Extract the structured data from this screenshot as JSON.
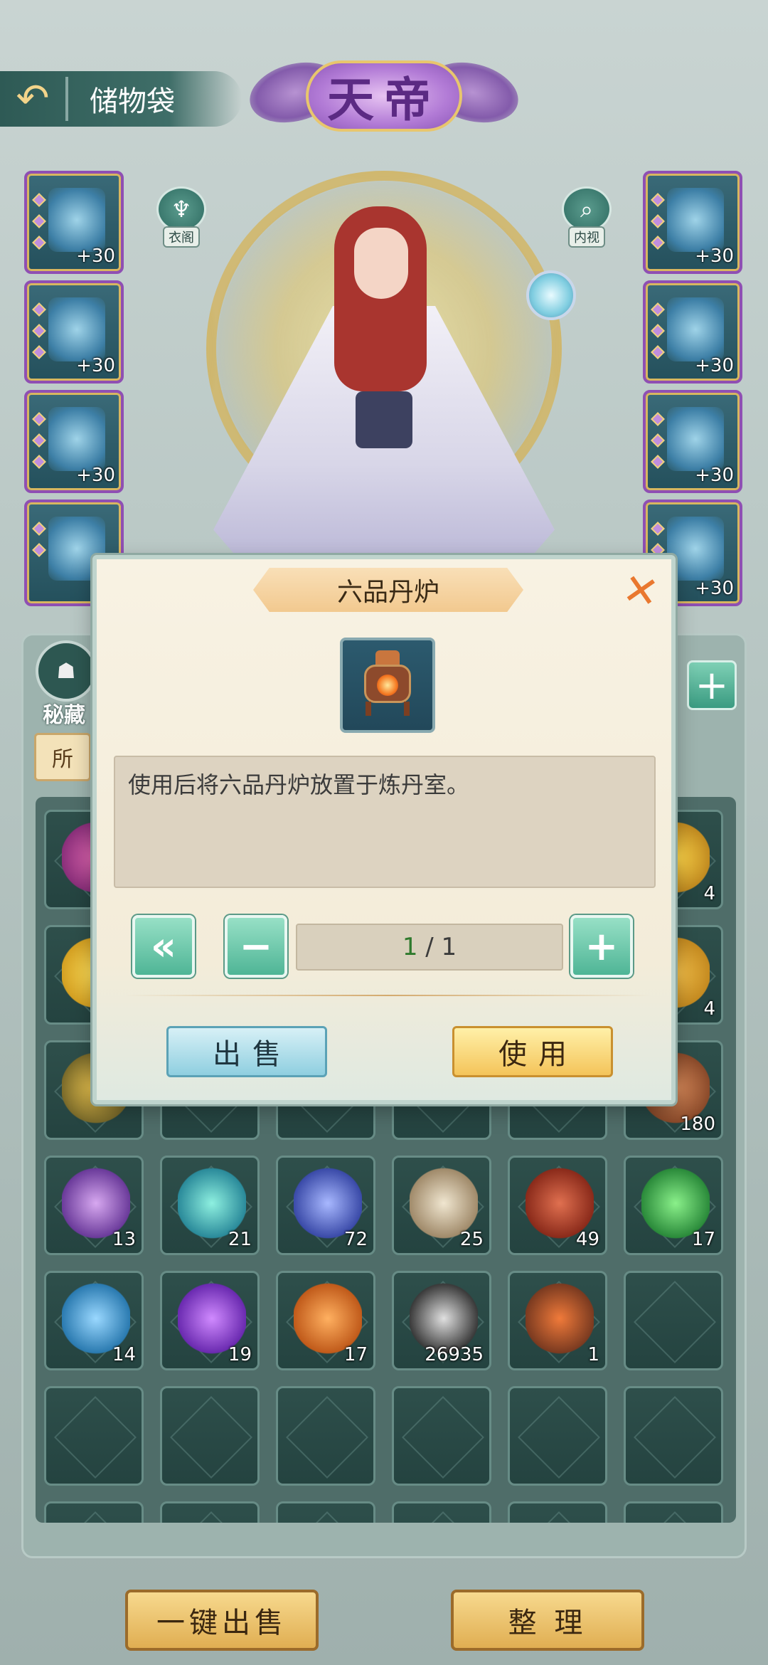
{
  "header": {
    "title": "储物袋",
    "rank": "天帝"
  },
  "side_buttons": {
    "wardrobe": "衣阁",
    "inspect": "内视"
  },
  "equipment_left": [
    {
      "level": "+30"
    },
    {
      "level": "+30"
    },
    {
      "level": "+30"
    },
    {
      "level": ""
    }
  ],
  "equipment_right": [
    {
      "level": "+30"
    },
    {
      "level": "+30"
    },
    {
      "level": "+30"
    },
    {
      "level": "+30"
    }
  ],
  "bag": {
    "secret_label": "秘藏",
    "tab_all": "所",
    "items": [
      {
        "count": ""
      },
      {
        "count": ""
      },
      {
        "count": ""
      },
      {
        "count": ""
      },
      {
        "count": ""
      },
      {
        "count": "4"
      },
      {
        "count": ""
      },
      {
        "count": ""
      },
      {
        "count": ""
      },
      {
        "count": ""
      },
      {
        "count": ""
      },
      {
        "count": "4"
      },
      {
        "count": ""
      },
      {
        "count": ""
      },
      {
        "count": ""
      },
      {
        "count": ""
      },
      {
        "count": ""
      },
      {
        "count": "180"
      },
      {
        "count": "13"
      },
      {
        "count": "21"
      },
      {
        "count": "72"
      },
      {
        "count": "25"
      },
      {
        "count": "49"
      },
      {
        "count": "17"
      },
      {
        "count": "14"
      },
      {
        "count": "19"
      },
      {
        "count": "17"
      },
      {
        "count": "26935"
      },
      {
        "count": "1"
      },
      {
        "count": ""
      }
    ]
  },
  "bottom": {
    "sell_all": "一键出售",
    "sort": "整 理"
  },
  "modal": {
    "title": "六品丹炉",
    "description": "使用后将六品丹炉放置于炼丹室。",
    "qty_current": "1",
    "qty_sep": " / ",
    "qty_max": "1",
    "sell_label": "出售",
    "use_label": "使用"
  },
  "colors": {
    "accent_green": "#4fb596",
    "gold": "#e0ae52",
    "purple_frame": "#8f4fb3"
  }
}
